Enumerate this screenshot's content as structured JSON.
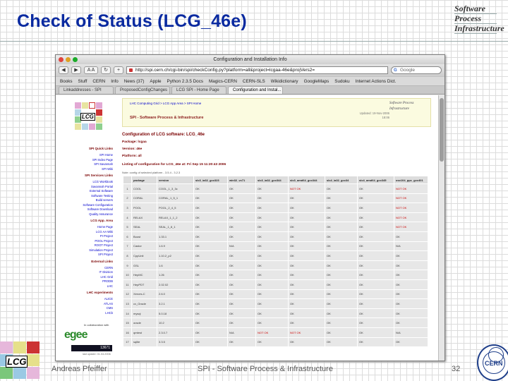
{
  "slide": {
    "title": "Check of Status (LCG_46e)",
    "logo_lines": [
      "Software",
      "Process",
      "Infrastructure"
    ],
    "footer_author": "Andreas Pfeiffer",
    "footer_center": "SPI - Software Process & Infrastructure",
    "page_number": "32",
    "lcg_logo_text": "LCG",
    "cern_logo_text": "CERN"
  },
  "browser": {
    "window_title": "Configuration and Installation Info",
    "back_label": "◀",
    "forward_label": "▶",
    "aa_label": "A A",
    "url": "http://spi.cern.ch/cgi-bin/spi/checkConfig.py?platform=all&project=lcgaa-46e&projVers2=",
    "search_placeholder": "Google",
    "bookmarks": [
      "Books",
      "Stuff",
      "CERN",
      "Info",
      "News (37)",
      "Apple",
      "Python 2.3.5 Docs",
      "Magics-CERN",
      "CERN-SLS",
      "Wikidictionary",
      "GoogleMaps",
      "Sudoku",
      "Internet Actions Dict."
    ],
    "tabs": [
      {
        "label": "Linkaddresses - SPI",
        "active": false
      },
      {
        "label": "ProposedConfigChanges",
        "active": false
      },
      {
        "label": "LCG SPI - Home Page",
        "active": false
      },
      {
        "label": "Configuration and Instal...",
        "active": true
      }
    ]
  },
  "page": {
    "breadcrumb": "LHC Computing Grid > LCG App Area > SPI Home",
    "header_title": "SPI - Software Process & Infrastructure",
    "header_logo": "Software Process Infrastructure",
    "updated": "Updated: 19-Nov-2006 18:06",
    "lcg_logo_text": "LCG",
    "sidebar": [
      {
        "text": "SPI Quick Links",
        "head": true
      },
      {
        "text": "SPI Home",
        "head": false
      },
      {
        "text": "SPI Index Page",
        "head": false
      },
      {
        "text": "SPI Savannah",
        "head": false
      },
      {
        "text": "SPI Wiki",
        "head": false
      },
      {
        "text": "SPI Services Links",
        "head": true
      },
      {
        "text": "LCG Workbook",
        "head": false
      },
      {
        "text": "Savannah Portal",
        "head": false
      },
      {
        "text": "External Software",
        "head": false
      },
      {
        "text": "Software Testing",
        "head": false
      },
      {
        "text": "Build servers",
        "head": false
      },
      {
        "text": "Software Configuration",
        "head": false
      },
      {
        "text": "Software Download",
        "head": false
      },
      {
        "text": "Quality Assurance",
        "head": false
      },
      {
        "text": "LCG App. Area",
        "head": true
      },
      {
        "text": "Home Page",
        "head": false
      },
      {
        "text": "LCG AA Wiki",
        "head": false
      },
      {
        "text": "PI Project",
        "head": false
      },
      {
        "text": "POOL Project",
        "head": false
      },
      {
        "text": "ROOT Project",
        "head": false
      },
      {
        "text": "Simulation Project",
        "head": false
      },
      {
        "text": "SPI Project",
        "head": false
      },
      {
        "text": "External Links",
        "head": true
      },
      {
        "text": "CERN",
        "head": false
      },
      {
        "text": "IT Division",
        "head": false
      },
      {
        "text": "LHC Grid",
        "head": false
      },
      {
        "text": "PRODB",
        "head": false
      },
      {
        "text": "LHC",
        "head": false
      },
      {
        "text": "LHC experiments",
        "head": true
      },
      {
        "text": "ALICE",
        "head": false
      },
      {
        "text": "ATLAS",
        "head": false
      },
      {
        "text": "CMS",
        "head": false
      },
      {
        "text": "LHCb",
        "head": false
      }
    ],
    "collab_text": "In collaboration with",
    "egee_text": "egee",
    "fc_text": "13671",
    "fc_sub": "last update: 01.04.2006",
    "config_title": "Configuration of LCG software: LCG_46e",
    "package_label": "Package: lcgaa",
    "version_label": "Version: 46e",
    "platform_label": "Platform: all",
    "listing_label": "Listing of configuration for LCG_46e at: Fri Sep 15 11:20:43 2006",
    "legend_line": "Note: config of selected platform - 3.5.4 - 3.2.3",
    "columns": [
      "",
      "package",
      "version",
      "slc3_ia32_gcc323",
      "win32_vc71",
      "slc3_ia32_gcc344",
      "slc3_amd64_gcc344",
      "slc4_ia32_gcc34",
      "slc4_amd64_gcc345",
      "osx104_ppc_gcc401"
    ],
    "rows": [
      [
        "1",
        "COOL",
        "COOL_1_3_3c",
        "OK",
        "OK",
        "OK",
        "NOT OK",
        "OK",
        "OK",
        "NOT OK"
      ],
      [
        "2",
        "CORAL",
        "CORAL_1_5_1",
        "OK",
        "OK",
        "OK",
        "OK",
        "OK",
        "OK",
        "NOT OK"
      ],
      [
        "3",
        "POOL",
        "POOL_2_4_5",
        "OK",
        "OK",
        "OK",
        "OK",
        "OK",
        "OK",
        "NOT OK"
      ],
      [
        "4",
        "RELAX",
        "RELAX_1_1_2",
        "OK",
        "OK",
        "OK",
        "OK",
        "OK",
        "OK",
        "NOT OK"
      ],
      [
        "5",
        "SEAL",
        "SEAL_1_8_1",
        "OK",
        "OK",
        "OK",
        "OK",
        "OK",
        "OK",
        "NOT OK"
      ],
      [
        "6",
        "Boost",
        "1.33.1",
        "OK",
        "OK",
        "OK",
        "OK",
        "OK",
        "OK",
        "OK"
      ],
      [
        "7",
        "Castor",
        "1.6.9",
        "OK",
        "N/A",
        "OK",
        "OK",
        "OK",
        "OK",
        "N/A"
      ],
      [
        "8",
        "CppUnit",
        "1.10.2_p2",
        "OK",
        "OK",
        "OK",
        "OK",
        "OK",
        "OK",
        "OK"
      ],
      [
        "9",
        "GSL",
        "1.6",
        "OK",
        "OK",
        "OK",
        "OK",
        "OK",
        "OK",
        "OK"
      ],
      [
        "10",
        "HepMC",
        "1.26",
        "OK",
        "OK",
        "OK",
        "OK",
        "OK",
        "OK",
        "OK"
      ],
      [
        "11",
        "HepPDT",
        "2.02.02",
        "OK",
        "OK",
        "OK",
        "OK",
        "OK",
        "OK",
        "OK"
      ],
      [
        "12",
        "Xerces-C",
        "2.6.0",
        "OK",
        "OK",
        "OK",
        "OK",
        "OK",
        "OK",
        "OK"
      ],
      [
        "13",
        "cx_Oracle",
        "3.2.1",
        "OK",
        "OK",
        "OK",
        "OK",
        "OK",
        "OK",
        "OK"
      ],
      [
        "14",
        "mysql",
        "5.0.18",
        "OK",
        "OK",
        "OK",
        "OK",
        "OK",
        "OK",
        "OK"
      ],
      [
        "15",
        "oracle",
        "10.2",
        "OK",
        "OK",
        "OK",
        "OK",
        "OK",
        "OK",
        "OK"
      ],
      [
        "16",
        "qmtest",
        "2.3.0.7",
        "OK",
        "N/A",
        "NOT OK",
        "NOT OK",
        "OK",
        "OK",
        "N/A"
      ],
      [
        "17",
        "sqlite",
        "3.3.5",
        "OK",
        "OK",
        "OK",
        "OK",
        "OK",
        "OK",
        "OK"
      ]
    ]
  },
  "colors": {
    "title": "#0a2aa0",
    "bad": "#cc0000",
    "heading": "#7a0000"
  }
}
